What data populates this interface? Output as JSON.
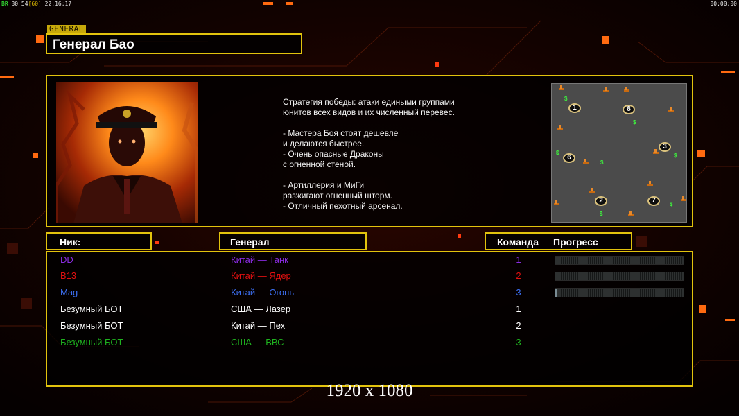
{
  "hud": {
    "left_prefix": "BR",
    "left_nums": "30 54",
    "left_fps": "[60]",
    "left_time": "22:16:17",
    "right_time": "00:00:00"
  },
  "general_tag": "GENERAL",
  "general_name": "Генерал Бао",
  "description": [
    "Стратегия победы: атаки едиными группами",
    "юнитов всех видов и их численный перевес.",
    "",
    "- Мастера Боя стоят дешевле",
    "и делаются быстрее.",
    "- Очень опасные Драконы",
    "с огненной стеной.",
    "",
    "- Артиллерия и МиГи",
    "разжигают огненный шторм.",
    "- Отличный пехотный арсенал."
  ],
  "minimap": {
    "start_positions": [
      "1",
      "8",
      "3",
      "6",
      "2",
      "7"
    ],
    "cash_icon": "$",
    "oil_icon": "oil-derrick-icon"
  },
  "headers": {
    "nick": "Ник:",
    "general": "Генерал",
    "team": "Команда",
    "progress": "Прогресс"
  },
  "players": [
    {
      "nick": "DD",
      "general": "Китай — Танк",
      "team": "1",
      "color": "#8a2be2",
      "progress": 0.0,
      "show_bar": true
    },
    {
      "nick": "B13",
      "general": "Китай — Ядер",
      "team": "2",
      "color": "#e01010",
      "progress": 0.0,
      "show_bar": true
    },
    {
      "nick": "Mag",
      "general": "Китай — Огонь",
      "team": "3",
      "color": "#3c6ef0",
      "progress": 0.01,
      "show_bar": true
    },
    {
      "nick": "Безумный БОТ",
      "general": "США — Лазер",
      "team": "1",
      "color": "#ffffff",
      "progress": 0.0,
      "show_bar": false
    },
    {
      "nick": "Безумный БОТ",
      "general": "Китай — Пех",
      "team": "2",
      "color": "#ffffff",
      "progress": 0.0,
      "show_bar": false
    },
    {
      "nick": "Безумный БОТ",
      "general": "США — ВВС",
      "team": "3",
      "color": "#1fb21f",
      "progress": 0.0,
      "show_bar": false
    }
  ],
  "resolution_label": "1920 x 1080",
  "colors": {
    "accent": "#e2c30d",
    "hud_orange": "#ff6a10"
  }
}
